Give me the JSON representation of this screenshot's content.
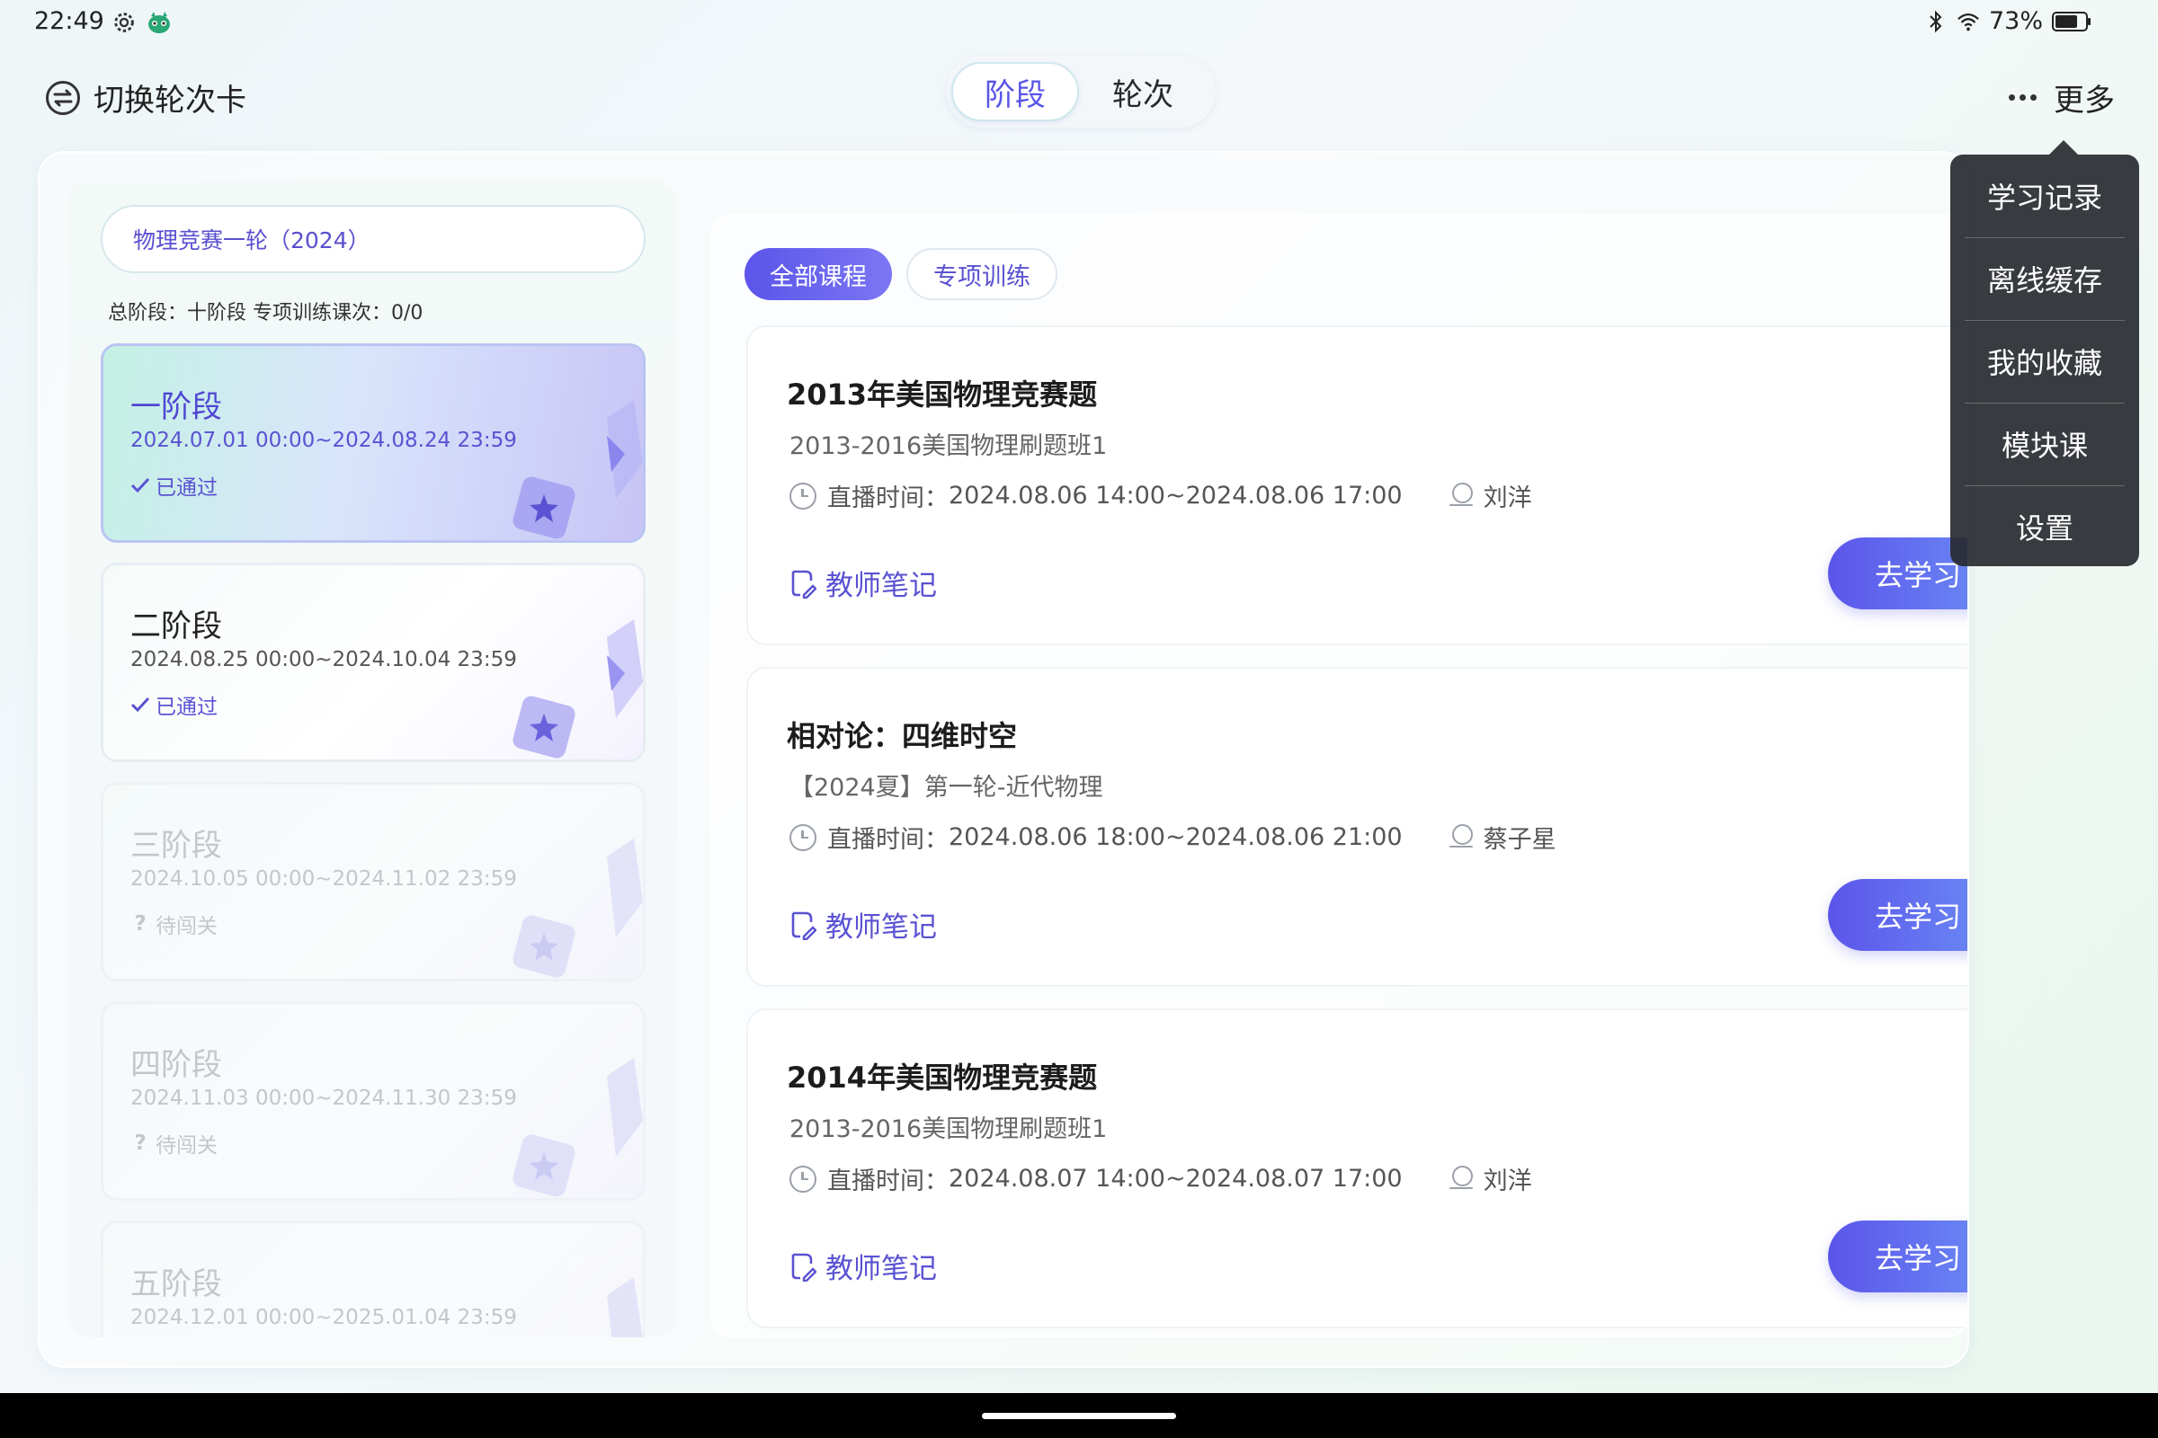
{
  "status_bar": {
    "time": "22:49",
    "battery": "73%"
  },
  "header": {
    "switch_label": "切换轮次卡",
    "segments": [
      {
        "label": "阶段"
      },
      {
        "label": "轮次"
      }
    ],
    "more_label": "更多"
  },
  "sidebar": {
    "course": "物理竞赛一轮（2024）",
    "summary": "总阶段：十阶段 专项训练课次：0/0",
    "stages": [
      {
        "title": "一阶段",
        "date": "2024.07.01 00:00~2024.08.24 23:59",
        "status": "已通过",
        "status_icon": "check-icon"
      },
      {
        "title": "二阶段",
        "date": "2024.08.25 00:00~2024.10.04 23:59",
        "status": "已通过",
        "status_icon": "check-icon"
      },
      {
        "title": "三阶段",
        "date": "2024.10.05 00:00~2024.11.02 23:59",
        "status": "待闯关",
        "status_icon": "question-icon"
      },
      {
        "title": "四阶段",
        "date": "2024.11.03 00:00~2024.11.30 23:59",
        "status": "待闯关",
        "status_icon": "question-icon"
      },
      {
        "title": "五阶段",
        "date": "2024.12.01 00:00~2025.01.04 23:59"
      }
    ]
  },
  "content": {
    "tabs": [
      {
        "label": "全部课程"
      },
      {
        "label": "专项训练"
      }
    ],
    "lessons": [
      {
        "title": "2013年美国物理竞赛题",
        "subtitle": "2013-2016美国物理刷题班1",
        "time_label": "直播时间：",
        "time": "2024.08.06 14:00~2024.08.06 17:00",
        "teacher": "刘洋",
        "notes": "教师笔记",
        "button": "去学习"
      },
      {
        "title": "相对论：四维时空",
        "subtitle": "【2024夏】第一轮-近代物理",
        "time_label": "直播时间：",
        "time": "2024.08.06 18:00~2024.08.06 21:00",
        "teacher": "蔡子星",
        "notes": "教师笔记",
        "button": "去学习"
      },
      {
        "title": "2014年美国物理竞赛题",
        "subtitle": "2013-2016美国物理刷题班1",
        "time_label": "直播时间：",
        "time": "2024.08.07 14:00~2024.08.07 17:00",
        "teacher": "刘洋",
        "notes": "教师笔记",
        "button": "去学习"
      }
    ]
  },
  "dropdown": {
    "items": [
      {
        "label": "学习记录"
      },
      {
        "label": "离线缓存"
      },
      {
        "label": "我的收藏"
      },
      {
        "label": "模块课"
      },
      {
        "label": "设置"
      }
    ]
  },
  "colors": {
    "accent": "#5a55e6",
    "accent_gradient_end": "#6c8ff6",
    "menu_bg": "#2a2c30"
  }
}
